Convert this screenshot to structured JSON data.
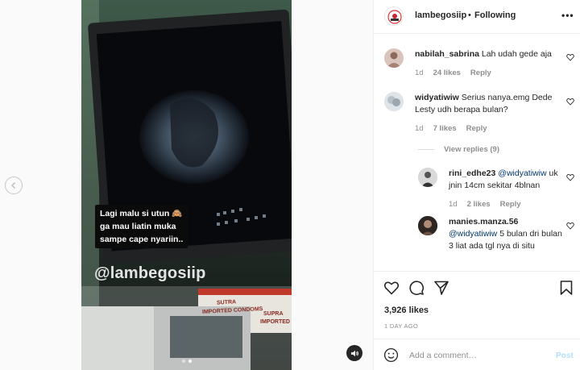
{
  "colors": {
    "link": "#00376b",
    "muted": "#8e8e8e",
    "text": "#262626",
    "post_disabled": "#b2dffc"
  },
  "media": {
    "caption_overlay": "Lagi malu si utun 🙈\nga mau liatin muka\nsampe cape nyariin..",
    "watermark": "@lambegosiip",
    "box_text_1": "SUTRA",
    "box_text_2": "IMPORTED CONDOMS",
    "box_text_3": "SUPRA",
    "box_text_4": "IMPORTED",
    "carousel_pages": 2,
    "carousel_active": 2
  },
  "header": {
    "username": "lambegosiip",
    "separator": "•",
    "follow_label": "Following"
  },
  "comments": [
    {
      "user": "nabilah_sabrina",
      "text": "Lah udah gede aja",
      "age": "1d",
      "likes": "24 likes",
      "reply": "Reply"
    },
    {
      "user": "widyatiwiw",
      "text": "Serius nanya.emg Dede Lesty udh berapa bulan?",
      "age": "1d",
      "likes": "7 likes",
      "reply": "Reply"
    }
  ],
  "view_replies": "View replies (9)",
  "replies": [
    {
      "user": "rini_edhe23",
      "mention": "@widyatiwiw",
      "text": "uk jnin 14cm sekitar 4blnan",
      "age": "1d",
      "likes": "2 likes",
      "reply": "Reply"
    },
    {
      "user": "manies.manza.56",
      "mention": "@widyatiwiw",
      "text": "5 bulan dri bulan 3 liat ada tgl nya di situ"
    }
  ],
  "footer": {
    "likes": "3,926 likes",
    "date": "1 DAY AGO",
    "placeholder": "Add a comment…",
    "post_label": "Post"
  },
  "icons": [
    "chevron-left-icon",
    "volume-icon",
    "more-icon",
    "heart-icon",
    "comment-icon",
    "share-icon",
    "bookmark-icon",
    "emoji-icon"
  ]
}
